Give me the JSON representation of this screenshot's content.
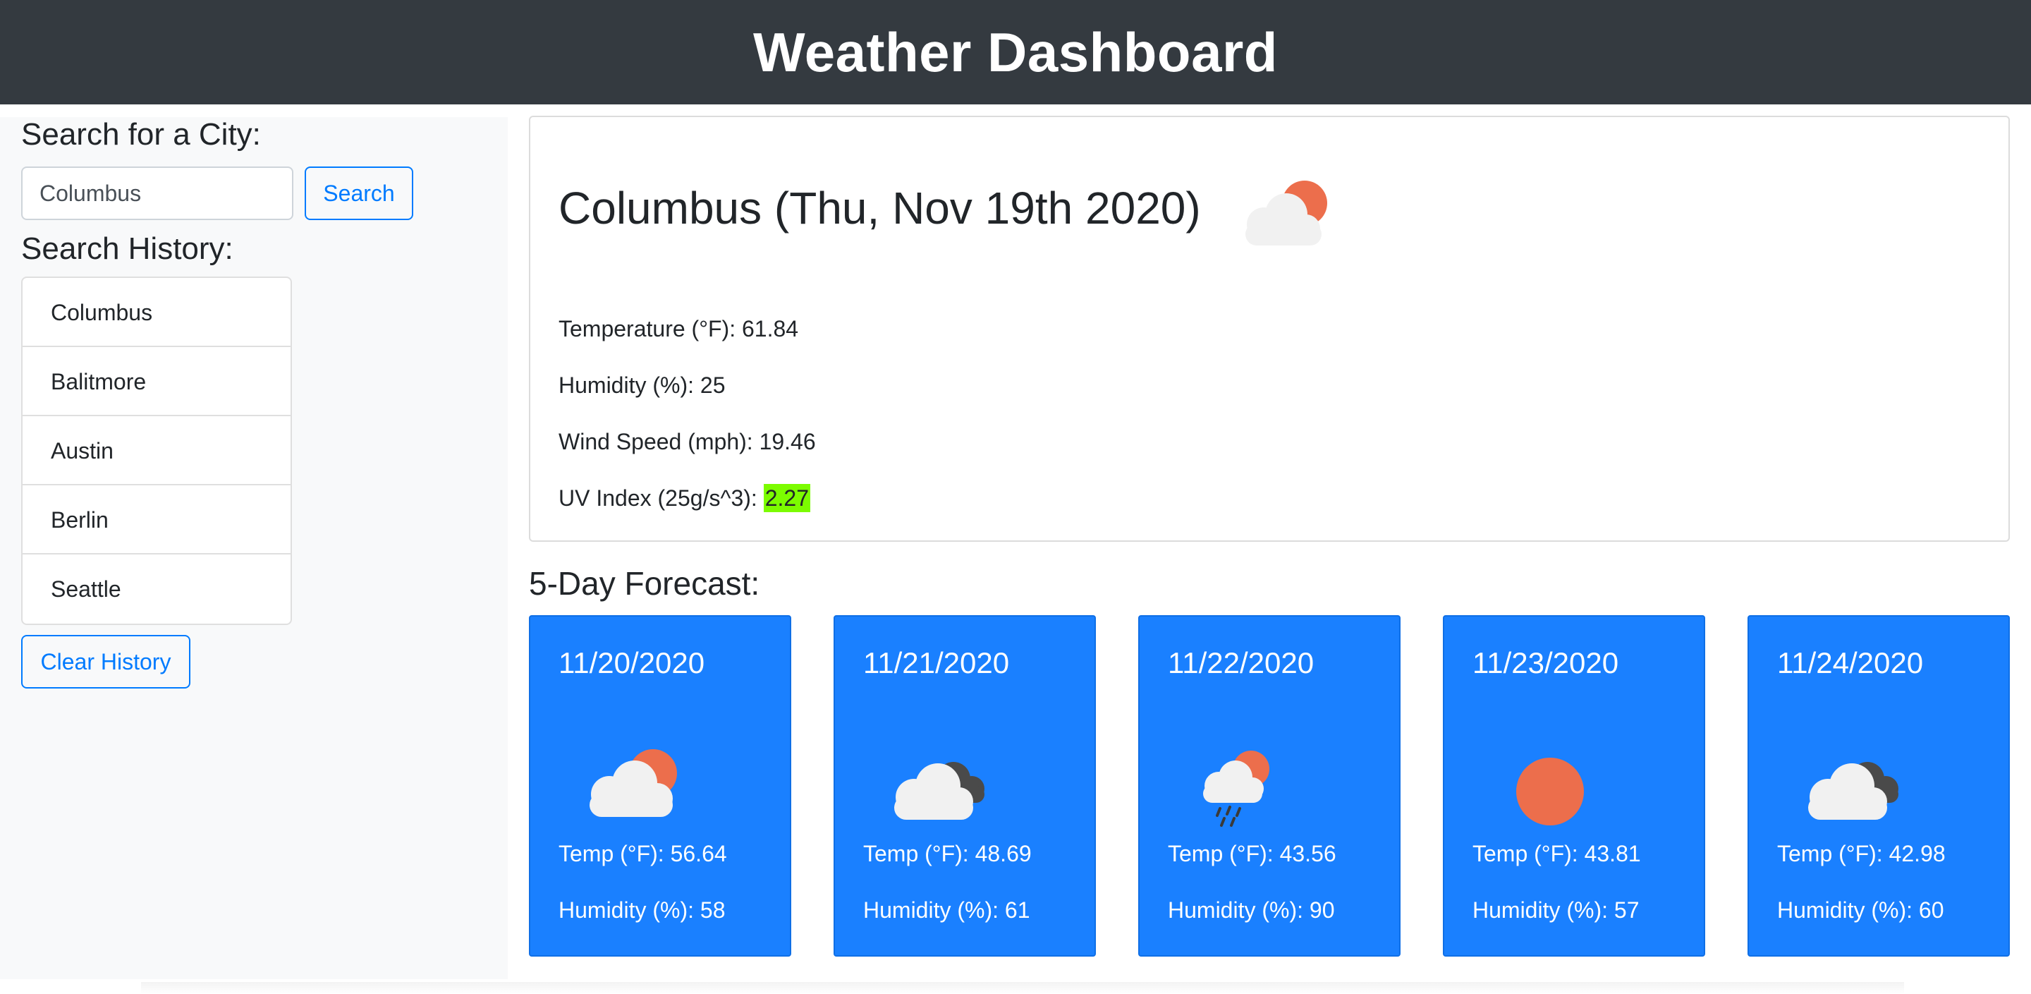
{
  "header": {
    "title": "Weather Dashboard"
  },
  "sidebar": {
    "search_title": "Search for a City:",
    "search_value": "Columbus",
    "search_button": "Search",
    "history_title": "Search History:",
    "history": [
      "Columbus",
      "Balitmore",
      "Austin",
      "Berlin",
      "Seattle"
    ],
    "clear_button": "Clear History"
  },
  "current": {
    "title": "Columbus (Thu, Nov 19th 2020)",
    "icon": "sun-behind-cloud-icon",
    "temp_label": "Temperature (°F): ",
    "temp_value": "61.84",
    "humidity_label": "Humidity (%): ",
    "humidity_value": "25",
    "wind_label": "Wind Speed (mph): ",
    "wind_value": "19.46",
    "uv_label": "UV Index (25g/s^3): ",
    "uv_value": "2.27",
    "uv_color": "#7cfc00"
  },
  "forecast": {
    "title": "5-Day Forecast:",
    "card_color": "#1a80ff",
    "days": [
      {
        "date": "11/20/2020",
        "icon": "sun-behind-cloud-icon",
        "temp": "Temp (°F): 56.64",
        "humidity": "Humidity (%): 58"
      },
      {
        "date": "11/21/2020",
        "icon": "broken-clouds-icon",
        "temp": "Temp (°F): 48.69",
        "humidity": "Humidity (%): 61"
      },
      {
        "date": "11/22/2020",
        "icon": "rain-sun-cloud-icon",
        "temp": "Temp (°F): 43.56",
        "humidity": "Humidity (%): 90"
      },
      {
        "date": "11/23/2020",
        "icon": "sun-icon",
        "temp": "Temp (°F): 43.81",
        "humidity": "Humidity (%): 57"
      },
      {
        "date": "11/24/2020",
        "icon": "broken-clouds-icon",
        "temp": "Temp (°F): 42.98",
        "humidity": "Humidity (%): 60"
      }
    ]
  }
}
